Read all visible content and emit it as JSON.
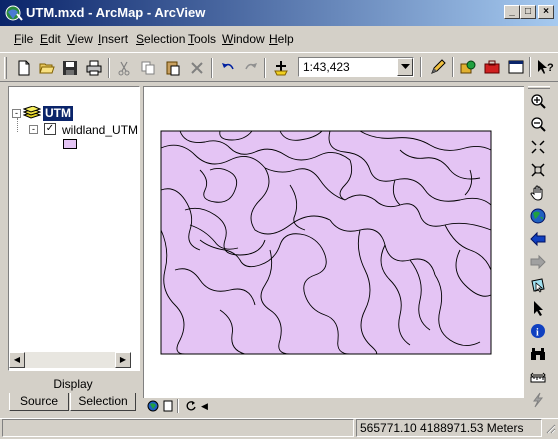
{
  "window": {
    "title": "UTM.mxd - ArcMap - ArcView",
    "minimize": "_",
    "maximize": "□",
    "close": "×"
  },
  "menu": [
    "File",
    "Edit",
    "View",
    "Insert",
    "Selection",
    "Tools",
    "Window",
    "Help"
  ],
  "menu_underline": [
    "F",
    "E",
    "V",
    "I",
    "S",
    "T",
    "W",
    "H"
  ],
  "toolbar": {
    "scale_value": "1:43,423"
  },
  "toc": {
    "data_frame": "UTM",
    "layer_name": "wildland_UTM",
    "layer_checked": true,
    "legend_fill": "#e4c4f4",
    "display_label": "Display",
    "tabs": [
      "Source",
      "Selection"
    ],
    "close_glyph": "×"
  },
  "map": {
    "polygon_fill": "#e4c4f4",
    "outline": "#000000"
  },
  "status": {
    "coordinates": "565771.10  4188971.53 Meters"
  }
}
